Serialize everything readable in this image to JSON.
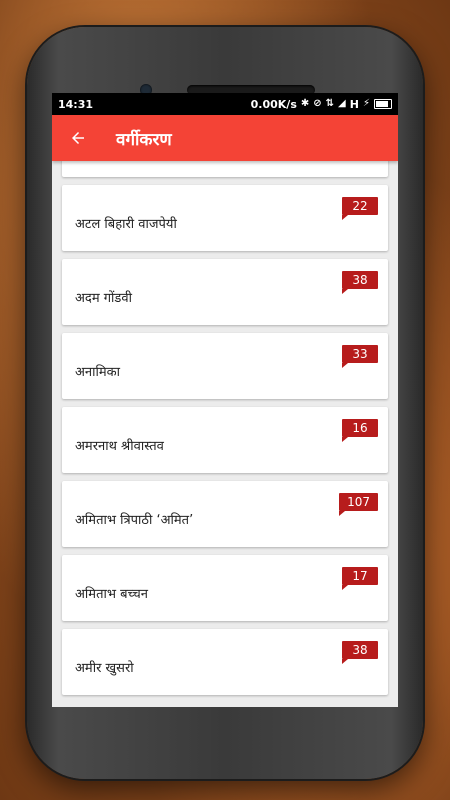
{
  "status": {
    "time": "14:31",
    "speed": "0.00K/s",
    "network": "H"
  },
  "toolbar": {
    "title": "वर्गीकरण",
    "back_icon": "arrow-back-icon"
  },
  "items": [
    {
      "name": "अटल बिहारी वाजपेयी",
      "count": "22"
    },
    {
      "name": "अदम गोंडवी",
      "count": "38"
    },
    {
      "name": "अनामिका",
      "count": "33"
    },
    {
      "name": "अमरनाथ श्रीवास्तव",
      "count": "16"
    },
    {
      "name": "अमिताभ त्रिपाठी ‘अमित’",
      "count": "107"
    },
    {
      "name": "अमिताभ बच्चन",
      "count": "17"
    },
    {
      "name": "अमीर खुसरो",
      "count": "38"
    }
  ],
  "colors": {
    "toolbar": "#f44336",
    "badge": "#b71c1c",
    "background": "#ececec"
  }
}
